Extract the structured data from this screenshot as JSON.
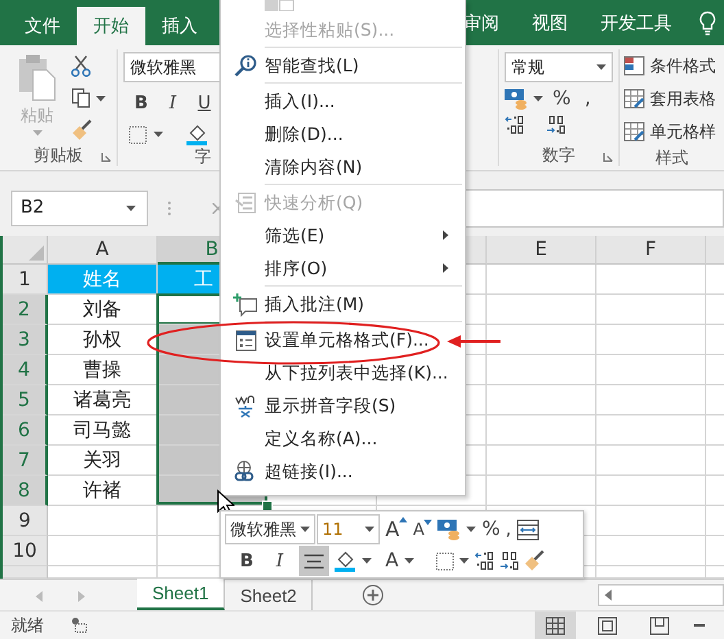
{
  "ribbon_tabs": [
    {
      "label": "文件",
      "selected": false
    },
    {
      "label": "开始",
      "selected": true
    },
    {
      "label": "插入",
      "selected": false
    },
    {
      "label": "审阅",
      "selected": false
    },
    {
      "label": "视图",
      "selected": false
    },
    {
      "label": "开发工具",
      "selected": false
    }
  ],
  "clipboard": {
    "paste_label": "粘贴",
    "group_label": "剪贴板"
  },
  "font_group": {
    "font_name": "微软雅黑",
    "bold": "B",
    "italic": "I",
    "underline": "U",
    "group_label": "字"
  },
  "number_group": {
    "format": "常规",
    "percent": "%",
    "comma": ",",
    "group_label": "数字"
  },
  "styles_group": {
    "items": [
      "条件格式",
      "套用表格",
      "单元格样"
    ],
    "group_label": "样式"
  },
  "name_box": "B2",
  "columns": [
    {
      "label": "A",
      "selected": false
    },
    {
      "label": "B",
      "selected": true
    },
    {
      "label": "E",
      "selected": false
    },
    {
      "label": "F",
      "selected": false
    }
  ],
  "rows": [
    {
      "number": "1",
      "kind": "header",
      "cells": [
        "姓名",
        "工"
      ],
      "selected": false,
      "active": false
    },
    {
      "number": "2",
      "kind": "data",
      "cells": [
        "刘备"
      ],
      "selected": true,
      "active": true
    },
    {
      "number": "3",
      "kind": "data",
      "cells": [
        "孙权"
      ],
      "selected": true,
      "active": false
    },
    {
      "number": "4",
      "kind": "data",
      "cells": [
        "曹操"
      ],
      "selected": true,
      "active": false
    },
    {
      "number": "5",
      "kind": "data",
      "cells": [
        "诸葛亮"
      ],
      "selected": true,
      "active": false
    },
    {
      "number": "6",
      "kind": "data",
      "cells": [
        "司马懿"
      ],
      "selected": true,
      "active": false
    },
    {
      "number": "7",
      "kind": "data",
      "cells": [
        "关羽"
      ],
      "selected": true,
      "active": false
    },
    {
      "number": "8",
      "kind": "data",
      "cells": [
        "许褚"
      ],
      "selected": true,
      "active": false
    },
    {
      "number": "9",
      "kind": "data",
      "selected": false,
      "active": false
    },
    {
      "number": "10",
      "kind": "data",
      "selected": false,
      "active": false
    }
  ],
  "context_menu": [
    {
      "label": "选择性粘贴(S)...",
      "kind": "plain",
      "disabled": true,
      "submenu": false,
      "separator_before": false
    },
    {
      "label": "智能查找(L)",
      "kind": "lookup",
      "disabled": false,
      "submenu": false,
      "separator_before": true
    },
    {
      "label": "插入(I)...",
      "kind": "plain",
      "disabled": false,
      "submenu": false,
      "separator_before": true
    },
    {
      "label": "删除(D)...",
      "kind": "plain",
      "disabled": false,
      "submenu": false,
      "separator_before": false
    },
    {
      "label": "清除内容(N)",
      "kind": "plain",
      "disabled": false,
      "submenu": false,
      "separator_before": false
    },
    {
      "label": "快速分析(Q)",
      "kind": "quick-analysis",
      "disabled": true,
      "submenu": false,
      "separator_before": true
    },
    {
      "label": "筛选(E)",
      "kind": "plain",
      "disabled": false,
      "submenu": true,
      "separator_before": false
    },
    {
      "label": "排序(O)",
      "kind": "plain",
      "disabled": false,
      "submenu": true,
      "separator_before": false
    },
    {
      "label": "插入批注(M)",
      "kind": "comment",
      "disabled": false,
      "submenu": false,
      "separator_before": true
    },
    {
      "label": "设置单元格格式(F)...",
      "kind": "format-cells",
      "disabled": false,
      "submenu": false,
      "separator_before": true
    },
    {
      "label": "从下拉列表中选择(K)...",
      "kind": "plain",
      "disabled": false,
      "submenu": false,
      "separator_before": false
    },
    {
      "label": "显示拼音字段(S)",
      "kind": "pinyin",
      "disabled": false,
      "submenu": false,
      "separator_before": false
    },
    {
      "label": "定义名称(A)...",
      "kind": "plain",
      "disabled": false,
      "submenu": false,
      "separator_before": false
    },
    {
      "label": "超链接(I)...",
      "kind": "hyperlink",
      "disabled": false,
      "submenu": false,
      "separator_before": false
    }
  ],
  "mini_toolbar": {
    "font_name": "微软雅黑",
    "font_size": "11",
    "grow": "A",
    "shrink": "A",
    "percent": "%",
    "comma": ",",
    "bold": "B",
    "italic": "I",
    "font_color": "A",
    "align_center_selected": true
  },
  "sheet_tabs": [
    {
      "label": "Sheet1",
      "selected": true
    },
    {
      "label": "Sheet2",
      "selected": false
    }
  ],
  "status_bar": {
    "text": "就绪",
    "views": [
      {
        "kind": "normal",
        "selected": true
      },
      {
        "kind": "page-layout",
        "selected": false
      },
      {
        "kind": "page-break",
        "selected": false
      }
    ]
  }
}
